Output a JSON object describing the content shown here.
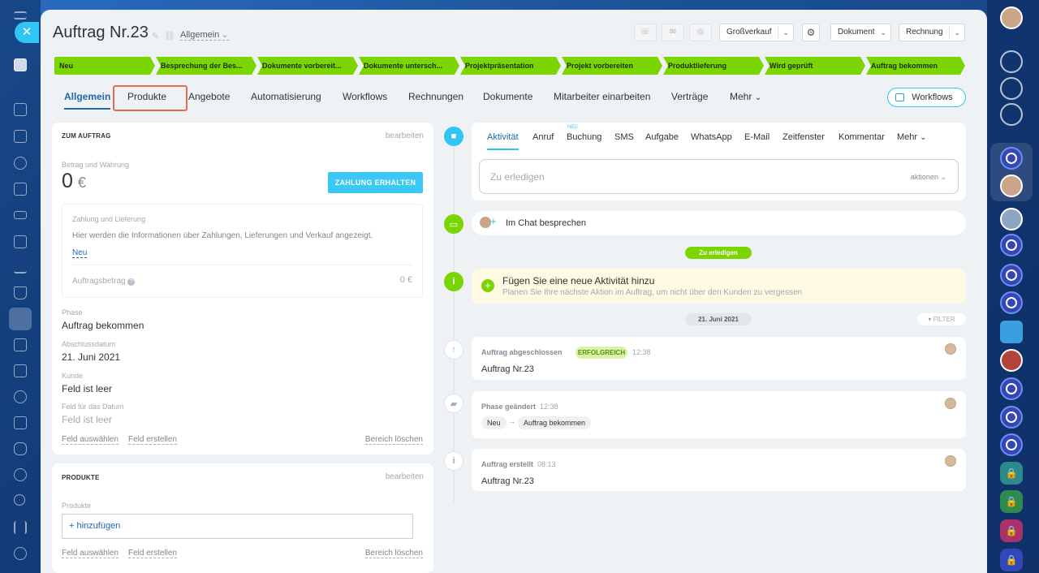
{
  "deal": {
    "title": "Auftrag Nr.23",
    "category": "Allgemein"
  },
  "toolbar": {
    "dd_pipeline": "Großverkauf",
    "dd_document": "Dokument",
    "dd_invoice": "Rechnung"
  },
  "stages": [
    "Neu",
    "Besprechung der Bes...",
    "Dokumente vorbereit...",
    "Dokumente untersch...",
    "Projektpräsentation",
    "Projekt vorbereiten",
    "Produktlieferung",
    "Wird geprüft",
    "Auftrag bekommen"
  ],
  "tabs": [
    "Allgemein",
    "Produkte",
    "Angebote",
    "Automatisierung",
    "Workflows",
    "Rechnungen",
    "Dokumente",
    "Mitarbeiter einarbeiten",
    "Verträge",
    "Mehr"
  ],
  "workflows_button": "Workflows",
  "about": {
    "header": "ZUM AUFTRAG",
    "edit": "bearbeiten",
    "amount_label": "Betrag und Währung",
    "amount_value": "0",
    "currency": "€",
    "pay_button": "ZAHLUNG ERHALTEN",
    "payment_label": "Zahlung und Lieferung",
    "payment_info": "Hier werden die Informationen über Zahlungen, Lieferungen und Verkauf angezeigt.",
    "new_link": "Neu",
    "order_amount_label": "Auftragsbetrag",
    "order_amount_value": "0 €",
    "phase_label": "Phase",
    "phase_value": "Auftrag bekommen",
    "close_date_label": "Abschlussdatum",
    "close_date_value": "21. Juni 2021",
    "client_label": "Kunde",
    "client_value": "Feld ist leer",
    "datefield_label": "Feld für das Datum",
    "datefield_value": "Feld ist leer",
    "select_field": "Feld auswählen",
    "create_field": "Feld erstellen",
    "delete_section": "Bereich löschen"
  },
  "products": {
    "header": "PRODUKTE",
    "edit": "bearbeiten",
    "label": "Produkte",
    "add": "+ hinzufügen",
    "select_field": "Feld auswählen",
    "create_field": "Feld erstellen",
    "delete_section": "Bereich löschen"
  },
  "activity": {
    "tabs": [
      "Aktivität",
      "Anruf",
      "Buchung",
      "SMS",
      "Aufgabe",
      "WhatsApp",
      "E-Mail",
      "Zeitfenster",
      "Kommentar",
      "Mehr"
    ],
    "new_badge": "NEU",
    "todo_placeholder": "Zu erledigen",
    "actions": "aktionen",
    "chat": "Im Chat besprechen",
    "todo_badge": "Zu erledigen",
    "add_title": "Fügen Sie eine neue Aktivität hinzu",
    "add_sub": "Planen Sie Ihre nächste Aktion im Auftrag, um nicht über den Kunden zu vergessen",
    "date_badge": "21. Juni 2021",
    "filter": "FILTER"
  },
  "timeline": [
    {
      "title": "Auftrag abgeschlossen",
      "badge": "ERFOLGREICH",
      "time": "12:38",
      "body": "Auftrag Nr.23"
    },
    {
      "title": "Phase geändert",
      "time": "12:38",
      "from": "Neu",
      "to": "Auftrag bekommen"
    },
    {
      "title": "Auftrag erstellt",
      "time": "08:13",
      "body": "Auftrag Nr.23"
    }
  ],
  "colors": {
    "accent": "#2067b0",
    "stage_green": "#7bd500",
    "highlight": "#e46d55",
    "success_badge": "#d9f2a9"
  }
}
